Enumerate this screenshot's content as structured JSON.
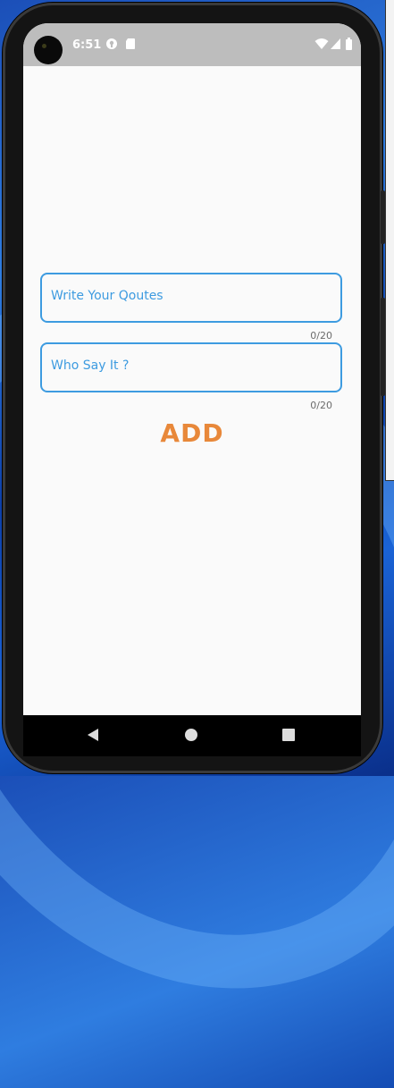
{
  "status_bar": {
    "time": "6:51",
    "icons": [
      "location-pin-icon",
      "sim-card-icon",
      "wifi-icon",
      "cellular-signal-icon",
      "battery-icon"
    ]
  },
  "form": {
    "quote_placeholder": "Write Your Qoutes",
    "quote_counter": "0/20",
    "author_placeholder": "Who Say It ?",
    "author_counter": "0/20",
    "add_label": "ADD"
  },
  "colors": {
    "field_border": "#3d9be0",
    "add_button": "#e8883a",
    "status_bar": "#bdbdbd"
  },
  "nav_bar": {
    "buttons": [
      "back-icon",
      "home-icon",
      "recents-icon"
    ]
  }
}
